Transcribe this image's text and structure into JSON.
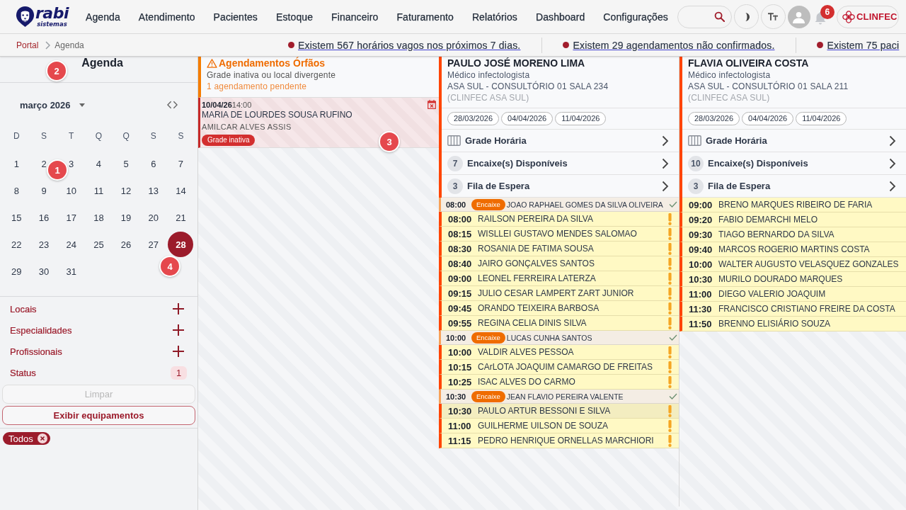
{
  "header": {
    "logo": {
      "name": "rabi",
      "tagline": "sistemas"
    },
    "nav": [
      "Agenda",
      "Atendimento",
      "Pacientes",
      "Estoque",
      "Financeiro",
      "Faturamento",
      "Relatórios",
      "Dashboard",
      "Configurações"
    ],
    "notifications": "6",
    "brand": "CLINFEC"
  },
  "breadcrumb": [
    {
      "label": "Portal",
      "kind": "link"
    },
    {
      "label": "Agenda",
      "kind": "current"
    }
  ],
  "alerts": [
    "Existem 567 horários vagos nos próximos 7 dias.",
    "Existem 29 agendamentos não confirmados.",
    "Existem 75 paci"
  ],
  "sidebar": {
    "title": "Agenda",
    "calendar": {
      "month": "março 2026",
      "weekdays": [
        "D",
        "S",
        "T",
        "Q",
        "Q",
        "S",
        "S"
      ],
      "days": [
        {
          "label": "1",
          "selected": false
        },
        {
          "label": "2",
          "selected": false
        },
        {
          "label": "3",
          "selected": false
        },
        {
          "label": "4",
          "selected": false
        },
        {
          "label": "5",
          "selected": false
        },
        {
          "label": "6",
          "selected": false
        },
        {
          "label": "7",
          "selected": false
        },
        {
          "label": "8",
          "selected": false
        },
        {
          "label": "9",
          "selected": false
        },
        {
          "label": "10",
          "selected": false
        },
        {
          "label": "11",
          "selected": false
        },
        {
          "label": "12",
          "selected": false
        },
        {
          "label": "13",
          "selected": false
        },
        {
          "label": "14",
          "selected": false
        },
        {
          "label": "15",
          "selected": false
        },
        {
          "label": "16",
          "selected": false
        },
        {
          "label": "17",
          "selected": false
        },
        {
          "label": "18",
          "selected": false
        },
        {
          "label": "19",
          "selected": false
        },
        {
          "label": "20",
          "selected": false
        },
        {
          "label": "21",
          "selected": false
        },
        {
          "label": "22",
          "selected": false
        },
        {
          "label": "23",
          "selected": false
        },
        {
          "label": "24",
          "selected": false
        },
        {
          "label": "25",
          "selected": false
        },
        {
          "label": "26",
          "selected": false
        },
        {
          "label": "27",
          "selected": false
        },
        {
          "label": "28",
          "selected": true
        },
        {
          "label": "29",
          "selected": false
        },
        {
          "label": "30",
          "selected": false
        },
        {
          "label": "31",
          "selected": false
        }
      ]
    },
    "filters": [
      {
        "label": "Locais",
        "kind": "add"
      },
      {
        "label": "Especialidades",
        "kind": "add"
      },
      {
        "label": "Profissionais",
        "kind": "add"
      },
      {
        "label": "Status",
        "kind": "count",
        "count": "1"
      }
    ],
    "buttons": [
      {
        "label": "Limpar",
        "disabled": true
      },
      {
        "label": "Exibir equipamentos",
        "disabled": false
      }
    ],
    "chips": [
      "Todos"
    ]
  },
  "orphans": {
    "title": "Agendamentos Órfãos",
    "subtitle": "Grade inativa ou local divergente",
    "pending": "1 agendamento pendente",
    "items": [
      {
        "date": "10/04/26",
        "time": "14:00",
        "patient": "MARIA DE LOURDES SOUSA RUFINO",
        "professional": "AMILCAR ALVES ASSIS",
        "tag": "Grade inativa"
      }
    ]
  },
  "professionals": [
    {
      "name": "PAULO JOSÉ MORENO LIMA",
      "specialty": "Médico infectologista",
      "location": "ASA SUL - CONSULTÓRIO 01 SALA 234",
      "unit": "(CLINFEC ASA SUL)",
      "dates": [
        "28/03/2026",
        "04/04/2026",
        "11/04/2026"
      ],
      "menu": [
        {
          "kind": "grid",
          "label": "Grade Horária"
        },
        {
          "kind": "count",
          "count": "7",
          "label": "Encaixe(s) Disponíveis"
        },
        {
          "kind": "count",
          "count": "3",
          "label": "Fila de Espera"
        }
      ],
      "appointments": [
        {
          "kind": "encaixe",
          "time": "08:00",
          "tag": "Encaixe",
          "name": "JOAO RAPHAEL GOMES DA SILVA OLIVEIRA",
          "confirmed": true,
          "warning": false,
          "selected": false
        },
        {
          "kind": "regular",
          "time": "08:00",
          "name": "RAILSON PEREIRA DA SILVA",
          "confirmed": false,
          "warning": true,
          "selected": false
        },
        {
          "kind": "regular",
          "time": "08:15",
          "name": "WISLLEI GUSTAVO MENDES SALOMAO",
          "confirmed": false,
          "warning": true,
          "selected": false
        },
        {
          "kind": "regular",
          "time": "08:30",
          "name": "ROSANIA DE FATIMA SOUSA",
          "confirmed": false,
          "warning": true,
          "selected": false
        },
        {
          "kind": "regular",
          "time": "08:40",
          "name": "JAIRO GONÇALVES SANTOS",
          "confirmed": false,
          "warning": true,
          "selected": false
        },
        {
          "kind": "regular",
          "time": "09:00",
          "name": "LEONEL FERREIRA LATERZA",
          "confirmed": false,
          "warning": true,
          "selected": false
        },
        {
          "kind": "regular",
          "time": "09:15",
          "name": "JULIO CESAR LAMPERT ZART JUNIOR",
          "confirmed": false,
          "warning": true,
          "selected": false
        },
        {
          "kind": "regular",
          "time": "09:45",
          "name": "ORANDO TEIXEIRA BARBOSA",
          "confirmed": false,
          "warning": true,
          "selected": false
        },
        {
          "kind": "regular",
          "time": "09:55",
          "name": "REGINA CELIA DINIS SILVA",
          "confirmed": false,
          "warning": true,
          "selected": false
        },
        {
          "kind": "encaixe",
          "time": "10:00",
          "tag": "Encaixe",
          "name": "LUCAS CUNHA SANTOS",
          "confirmed": true,
          "warning": false,
          "selected": false
        },
        {
          "kind": "regular",
          "time": "10:00",
          "name": "VALDIR ALVES PESSOA",
          "confirmed": false,
          "warning": true,
          "selected": false
        },
        {
          "kind": "regular",
          "time": "10:15",
          "name": "CArLOTA JOAQUIM CAMARGO DE FREITAS",
          "confirmed": false,
          "warning": true,
          "selected": false
        },
        {
          "kind": "regular",
          "time": "10:25",
          "name": "ISAC ALVES DO CARMO",
          "confirmed": false,
          "warning": true,
          "selected": false
        },
        {
          "kind": "encaixe",
          "time": "10:30",
          "tag": "Encaixe",
          "name": "JEAN FLAVIO PEREIRA VALENTE",
          "confirmed": true,
          "warning": false,
          "selected": false
        },
        {
          "kind": "regular",
          "time": "10:30",
          "name": "PAULO ARTUR BESSONI E SILVA",
          "confirmed": false,
          "warning": true,
          "selected": true
        },
        {
          "kind": "regular",
          "time": "11:00",
          "name": "GUILHERME UILSON DE SOUZA",
          "confirmed": false,
          "warning": true,
          "selected": false
        },
        {
          "kind": "regular",
          "time": "11:15",
          "name": "PEDRO HENRIQUE ORNELLAS MARCHIORI",
          "confirmed": false,
          "warning": true,
          "selected": false
        }
      ]
    },
    {
      "name": "FLAVIA OLIVEIRA COSTA",
      "specialty": "Médico infectologista",
      "location": "ASA SUL - CONSULTÓRIO 01 SALA 211",
      "unit": "(CLINFEC ASA SUL)",
      "dates": [
        "28/03/2026",
        "04/04/2026",
        "11/04/2026"
      ],
      "menu": [
        {
          "kind": "grid",
          "label": "Grade Horária"
        },
        {
          "kind": "count",
          "count": "10",
          "label": "Encaixe(s) Disponíveis"
        },
        {
          "kind": "count",
          "count": "3",
          "label": "Fila de Espera"
        }
      ],
      "appointments": [
        {
          "kind": "regular",
          "time": "09:00",
          "name": "BRENO MARQUES RIBEIRO DE FARIA",
          "selected": false
        },
        {
          "kind": "regular",
          "time": "09:20",
          "name": "FABIO DEMARCHI MELO",
          "selected": false
        },
        {
          "kind": "regular",
          "time": "09:30",
          "name": "TIAGO BERNARDO DA SILVA",
          "selected": false
        },
        {
          "kind": "regular",
          "time": "09:40",
          "name": "MARCOS ROGERIO MARTINS COSTA",
          "selected": false
        },
        {
          "kind": "regular",
          "time": "10:00",
          "name": "WALTER AUGUSTO VELASQUEZ GONZALES",
          "selected": false
        },
        {
          "kind": "regular",
          "time": "10:30",
          "name": "MURILO DOURADO MARQUES",
          "selected": false
        },
        {
          "kind": "regular",
          "time": "11:00",
          "name": "DIEGO VALERIO JOAQUIM",
          "selected": false
        },
        {
          "kind": "regular",
          "time": "11:30",
          "name": "FRANCISCO CRISTIANO FREIRE DA COSTA",
          "selected": false
        },
        {
          "kind": "regular",
          "time": "11:50",
          "name": "BRENNO ELISIÁRIO SOUZA",
          "selected": false
        }
      ]
    }
  ],
  "markers": [
    "1",
    "2",
    "3",
    "4"
  ]
}
